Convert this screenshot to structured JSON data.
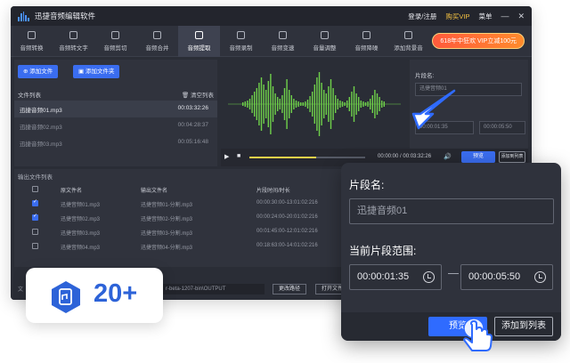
{
  "app": {
    "title": "迅捷音频编辑软件",
    "account": "登录/注册",
    "vip": "购买VIP",
    "menu": "菜单"
  },
  "toolbar": {
    "tools": [
      "音频转换",
      "音频转文字",
      "音频剪切",
      "音频合并",
      "音频提取",
      "音频录制",
      "音频变速",
      "音量调整",
      "音频降噪",
      "添加背景音"
    ],
    "active_index": 4,
    "promo": "618年中狂欢 VIP立减100元"
  },
  "left_panel": {
    "add_file": "添加文件",
    "add_folder": "添加文件夹",
    "list_title": "文件列表",
    "clear_list": "清空列表",
    "files": [
      {
        "name": "迅捷音频01.mp3",
        "duration": "00:03:32:26"
      },
      {
        "name": "迅捷音频02.mp3",
        "duration": "00:04:28:37"
      },
      {
        "name": "迅捷音频03.mp3",
        "duration": "00:05:16:48"
      }
    ]
  },
  "player": {
    "time": "00:00:00 / 00:03:32:26",
    "preview": "预览",
    "add_to_list": "添加到列表"
  },
  "right_panel": {
    "segment_label": "片段名:",
    "segment_value": "迅捷音频01",
    "range_label": "当前片段范围:",
    "start": "00:00:01:35",
    "end": "00:00:05:50"
  },
  "output": {
    "caption": "输出文件列表",
    "headers": [
      "原文件名",
      "输出文件名",
      "片段时间/时长"
    ],
    "rows": [
      {
        "src": "迅捷音频01.mp3",
        "out": "迅捷音频01-分割.mp3",
        "time": "00:00:30:00-13:01:02:216",
        "checked": true
      },
      {
        "src": "迅捷音频02.mp3",
        "out": "迅捷音频02-分割.mp3",
        "time": "00:00:24:00-20:01:02:216",
        "checked": true
      },
      {
        "src": "迅捷音频03.mp3",
        "out": "迅捷音频03-分割.mp3",
        "time": "00:01:45:00-12:01:02:216",
        "checked": false
      },
      {
        "src": "迅捷音频04.mp3",
        "out": "迅捷音频04-分割.mp3",
        "time": "00:18:63:00-14:01:02:216",
        "checked": false
      }
    ]
  },
  "bottom": {
    "path": "r-beta-1207-bin\\OUTPUT",
    "change_path": "更改路径",
    "open_folder": "打开文件"
  },
  "badge": {
    "count": "20+"
  },
  "zoom": {
    "segment_label": "片段名:",
    "segment_placeholder": "迅捷音频01",
    "range_label": "当前片段范围:",
    "start": "00:00:01:35",
    "end": "00:00:05:50",
    "preview": "预览",
    "add_to_list": "添加到列表"
  },
  "colors": {
    "accent": "#2f6bff",
    "wave": "#6fd14a",
    "promo": "#ff5a3c",
    "vip": "#f5c242"
  }
}
